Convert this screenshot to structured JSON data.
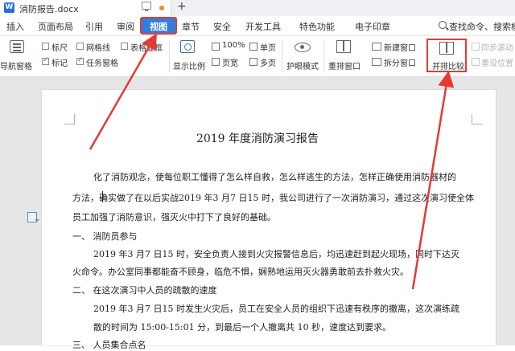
{
  "titlebar": {
    "doc_tab_title": "消防报告.docx",
    "new_tab": "+"
  },
  "menu": {
    "items": [
      "插入",
      "页面布局",
      "引用",
      "审阅",
      "视图",
      "章节",
      "安全",
      "开发工具",
      "特色功能",
      "电子印章"
    ],
    "active": "视图",
    "search_cmd": "查找命令、搜索模板"
  },
  "ribbon": {
    "nav_pane": "导航窗格",
    "ruler": "标尺",
    "gridlines": "网格线",
    "table_frame": "表格虚框",
    "mark": "标记",
    "task_pane": "任务窗格",
    "show_ratio": "显示比例",
    "zoom": "100%",
    "page_width": "页宽",
    "single_page": "单页",
    "multi_page": "多页",
    "eye_mode": "护眼模式",
    "rearrange": "重排窗口",
    "new_window": "新建窗口",
    "split_window": "拆分窗口",
    "side_by_side": "并排比较",
    "sync_scroll": "同步滚动",
    "reset_position": "重设位置"
  },
  "document": {
    "title": "2019 年度消防演习报告",
    "lines": [
      "化了消防观念，使每位职工懂得了怎么样自救，怎么样逃生的方法，怎样正确使用消防器材的",
      "方法，确实做了在以后实战2019 年3 月7 日15 时，我公司进行了一次消防演习，通过这次演习使全体",
      "员工加强了消防意识，强灭火中打下了良好的基础。",
      "一、   消防员参与",
      "2019 年3 月7 日15 时，安全负责人接到火灾报警信息后，均迅速赶到起火现场，同时下达灭",
      "火命令。办公室同事都能奋不顾身，临危不惧，娴熟地运用灭火器勇敢前去扑救火灾。",
      "二、   在这次演习中人员的疏散的速度",
      "2019 年3 月7 日15 时发生火灾后，员工在安全人员的组织下迅速有秩序的撤离，这次演练疏",
      "散的时间为 15:00-15:01 分，到最后一个人撤离共 10 秒，速度达到要求。",
      "三、   人员集合点名"
    ]
  },
  "colors": {
    "accent": "#2f7fe0",
    "annotation": "#e53935"
  }
}
